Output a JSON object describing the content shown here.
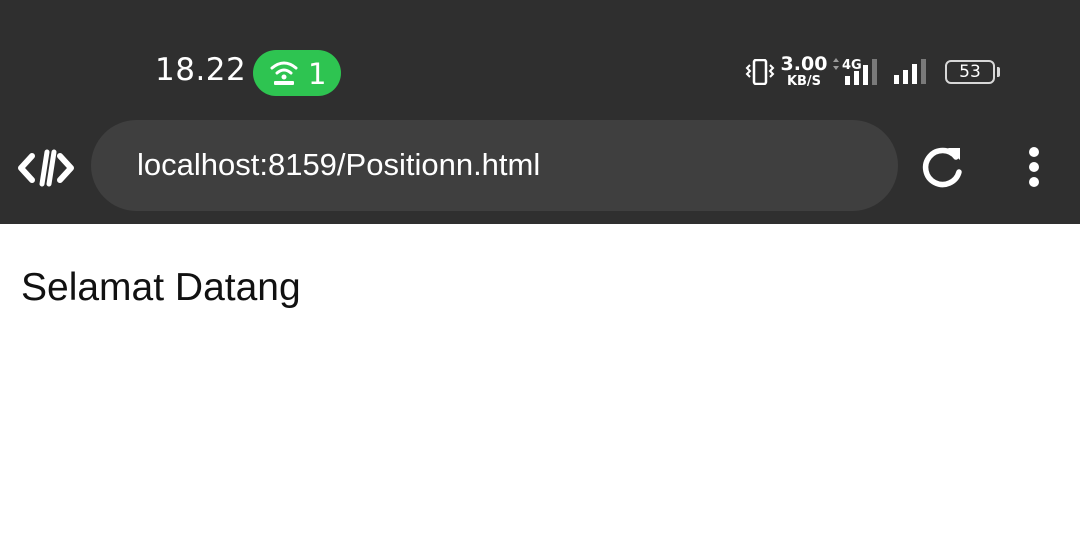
{
  "status_bar": {
    "time": "18.22",
    "hotspot_count": "1",
    "net_speed_value": "3.00",
    "net_speed_unit": "KB/S",
    "network_type": "4G",
    "battery_level": "53",
    "hotspot_color": "#2ec451",
    "icons": [
      "hotspot-icon",
      "vibrate-icon",
      "signal-4g-icon",
      "signal-icon",
      "battery-icon"
    ]
  },
  "toolbar": {
    "url": "localhost:8159/Positionn.html",
    "icons": [
      "code-logo-icon",
      "reload-icon",
      "more-vertical-icon"
    ]
  },
  "page": {
    "heading": "Selamat Datang"
  }
}
